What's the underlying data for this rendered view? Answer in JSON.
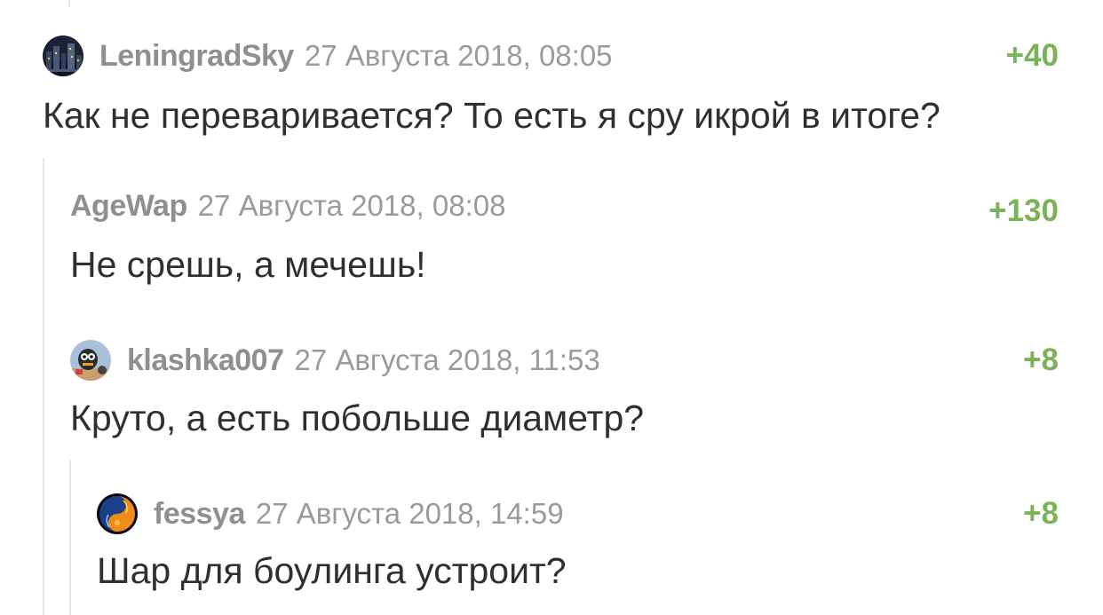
{
  "colors": {
    "rating_positive": "#79b356",
    "username": "#8f8f8f",
    "timestamp": "#9a9a9a",
    "text": "#2f2f2f",
    "thread_line": "#e6e6e6"
  },
  "comments": [
    {
      "username": "LeningradSky",
      "timestamp": "27 Августа 2018, 08:05",
      "rating": "+40",
      "text": "Как не переваривается? То есть я сру икрой в итоге?",
      "avatar_icon": "city-night-avatar-icon"
    },
    {
      "username": "AgeWap",
      "timestamp": "27 Августа 2018, 08:08",
      "rating": "+130",
      "text": "Не срешь, а мечешь!",
      "avatar_icon": null
    },
    {
      "username": "klashka007",
      "timestamp": "27 Августа 2018, 11:53",
      "rating": "+8",
      "text": "Круто, а есть побольше диаметр?",
      "avatar_icon": "robot-avatar-icon"
    },
    {
      "username": "fessya",
      "timestamp": "27 Августа 2018, 14:59",
      "rating": "+8",
      "text": "Шар для боулинга устроит?",
      "avatar_icon": "fire-ice-yinyang-avatar-icon"
    }
  ]
}
